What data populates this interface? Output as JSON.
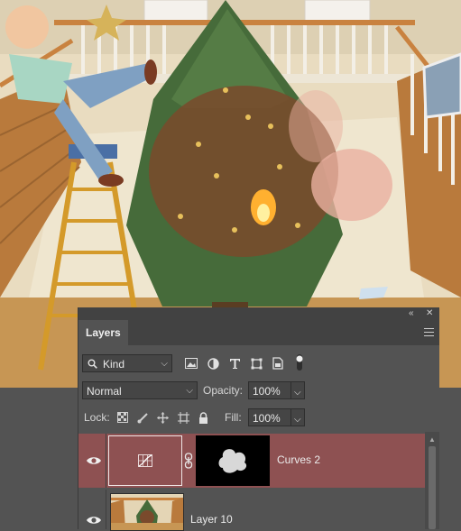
{
  "panel": {
    "title": "Layers",
    "collapse_glyph": "«",
    "close_glyph": "✕",
    "menu_icon": "panel-menu-icon"
  },
  "filter": {
    "label": "Kind",
    "icons": [
      "search-icon",
      "image-filter-icon",
      "adjustment-filter-icon",
      "type-filter-icon",
      "shape-filter-icon",
      "smart-object-filter-icon",
      "filter-toggle-icon"
    ]
  },
  "blend": {
    "mode": "Normal",
    "opacity_label": "Opacity:",
    "opacity_value": "100%",
    "lock_label": "Lock:",
    "lock_icons": [
      "lock-transparent-pixels-icon",
      "lock-image-pixels-icon",
      "lock-position-icon",
      "lock-artboard-icon",
      "lock-all-icon"
    ],
    "fill_label": "Fill:",
    "fill_value": "100%"
  },
  "layers": [
    {
      "name": "Curves 2",
      "type": "adjustment",
      "selected": true,
      "visible": true
    },
    {
      "name": "Layer 10",
      "type": "pixel",
      "selected": false,
      "visible": true
    }
  ],
  "colors": {
    "panel_bg": "#535353",
    "header_bg": "#424242",
    "selected_layer": "#8e5152",
    "field_bg": "#454545",
    "text": "#d6d6d6"
  }
}
